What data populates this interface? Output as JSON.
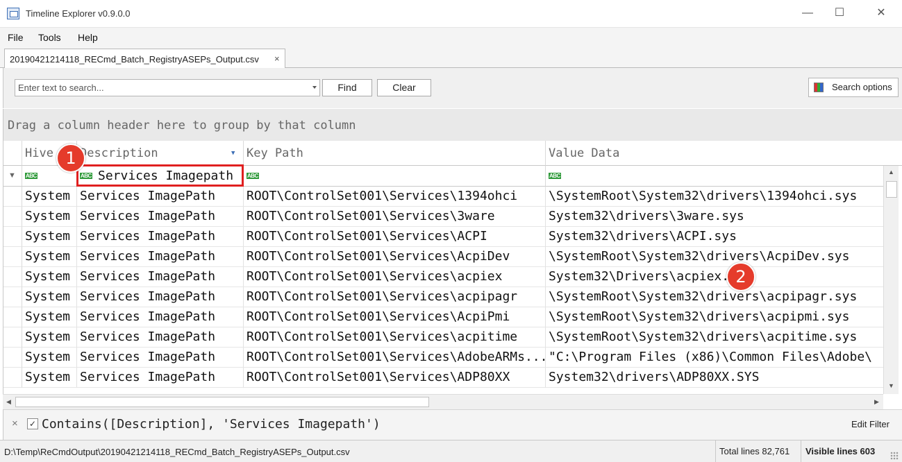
{
  "window": {
    "title": "Timeline Explorer v0.9.0.0",
    "minimize_glyph": "—",
    "maximize_glyph": "☐",
    "close_glyph": "✕"
  },
  "menu": [
    "File",
    "Tools",
    "Help"
  ],
  "tab": {
    "label": "20190421214118_RECmd_Batch_RegistryASEPs_Output.csv",
    "close_glyph": "×"
  },
  "search": {
    "placeholder": "Enter text to search...",
    "find_label": "Find",
    "clear_label": "Clear",
    "options_label": "Search options"
  },
  "group_panel": {
    "text": "Drag a column header here to group by that column"
  },
  "grid": {
    "columns": [
      "Hive",
      "Description",
      "Key Path",
      "Value Data"
    ],
    "filter_row": {
      "description": "Services Imagepath"
    },
    "rows": [
      [
        "System",
        "Services ImagePath",
        "ROOT\\ControlSet001\\Services\\1394ohci",
        "\\SystemRoot\\System32\\drivers\\1394ohci.sys"
      ],
      [
        "System",
        "Services ImagePath",
        "ROOT\\ControlSet001\\Services\\3ware",
        "System32\\drivers\\3ware.sys"
      ],
      [
        "System",
        "Services ImagePath",
        "ROOT\\ControlSet001\\Services\\ACPI",
        "System32\\drivers\\ACPI.sys"
      ],
      [
        "System",
        "Services ImagePath",
        "ROOT\\ControlSet001\\Services\\AcpiDev",
        "\\SystemRoot\\System32\\drivers\\AcpiDev.sys"
      ],
      [
        "System",
        "Services ImagePath",
        "ROOT\\ControlSet001\\Services\\acpiex",
        "System32\\Drivers\\acpiex.sys"
      ],
      [
        "System",
        "Services ImagePath",
        "ROOT\\ControlSet001\\Services\\acpipagr",
        "\\SystemRoot\\System32\\drivers\\acpipagr.sys"
      ],
      [
        "System",
        "Services ImagePath",
        "ROOT\\ControlSet001\\Services\\AcpiPmi",
        "\\SystemRoot\\System32\\drivers\\acpipmi.sys"
      ],
      [
        "System",
        "Services ImagePath",
        "ROOT\\ControlSet001\\Services\\acpitime",
        "\\SystemRoot\\System32\\drivers\\acpitime.sys"
      ],
      [
        "System",
        "Services ImagePath",
        "ROOT\\ControlSet001\\Services\\AdobeARMs...",
        "\"C:\\Program Files (x86)\\Common Files\\Adobe\\"
      ],
      [
        "System",
        "Services ImagePath",
        "ROOT\\ControlSet001\\Services\\ADP80XX",
        "System32\\drivers\\ADP80XX.SYS"
      ]
    ]
  },
  "filter_panel": {
    "close_glyph": "×",
    "check_glyph": "✓",
    "expression": "Contains([Description], 'Services Imagepath')",
    "edit_label": "Edit Filter"
  },
  "status": {
    "path": "D:\\Temp\\ReCmdOutput\\20190421214118_RECmd_Batch_RegistryASEPs_Output.csv",
    "total": "Total lines 82,761",
    "visible": "Visible lines 603"
  },
  "annotations": {
    "badge1": "1",
    "badge2": "2"
  },
  "colors": {
    "badge": "#e53b2b",
    "highlight": "#e02020",
    "abc_icon": "#2f9a3a"
  }
}
